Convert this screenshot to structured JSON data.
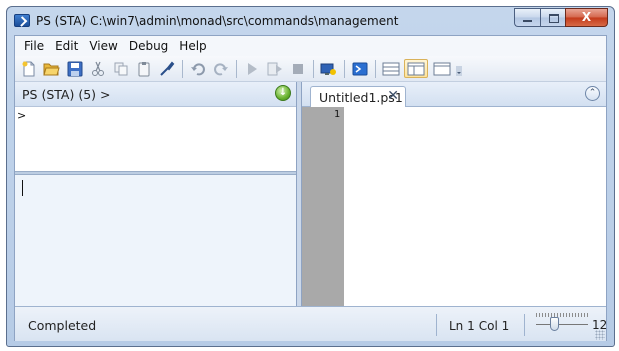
{
  "window": {
    "title": "PS (STA)  C:\\win7\\admin\\monad\\src\\commands\\management",
    "close_glyph": "X"
  },
  "menu": [
    "File",
    "Edit",
    "View",
    "Debug",
    "Help"
  ],
  "toolbar": {
    "icons": [
      "new-file-icon",
      "open-folder-icon",
      "save-icon",
      "cut-icon",
      "copy-icon",
      "paste-icon",
      "clear-icon",
      "undo-icon",
      "redo-icon",
      "run-script-icon",
      "run-selection-icon",
      "stop-icon",
      "new-remote-tab-icon",
      "powershell-icon",
      "layout-top-icon",
      "layout-right-icon",
      "layout-max-icon"
    ]
  },
  "console": {
    "header": "PS (STA) (5) >",
    "output": ">",
    "input": ""
  },
  "editor": {
    "tab_label": "Untitled1.ps1",
    "tab_close": "✕",
    "line_numbers": [
      "1"
    ]
  },
  "status": {
    "text": "Completed",
    "ln": "Ln 1",
    "col": "Col 1",
    "zoom": "12"
  },
  "colors": {
    "frame": "#b6cbe6",
    "gutter": "#a9a9a9",
    "input_bg": "#eef4fb",
    "run_green": "#68b22e"
  }
}
